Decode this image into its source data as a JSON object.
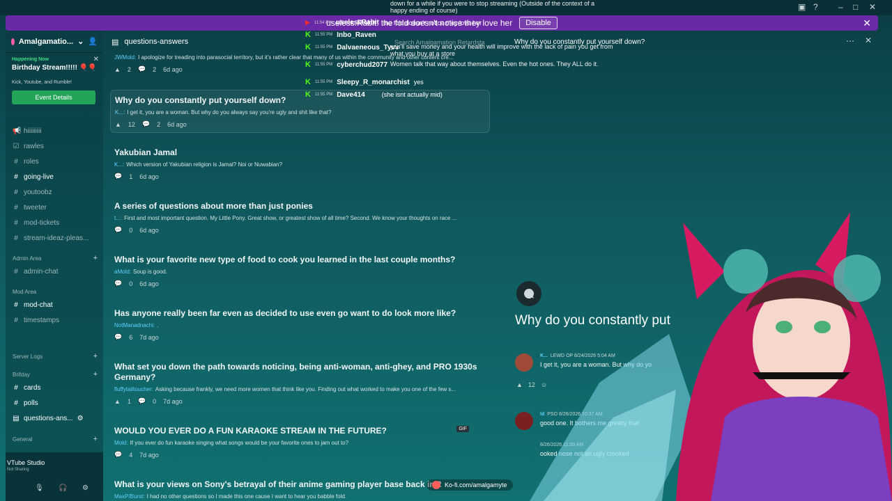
{
  "notice": {
    "text": "useless.Rabit: the fold doesn't notice they love her",
    "disable_label": "Disable"
  },
  "sidebar": {
    "server_name": "Amalgamatio...",
    "event": {
      "happening": "Happening Now",
      "title": "Birthday Stream!!!!! 🎈🎈",
      "location": "Kick, Youtube, and Rumble!",
      "button": "Event Details"
    },
    "channels": [
      {
        "icon": "megaphone-icon",
        "name": "hiiiiiiiii"
      },
      {
        "icon": "rules-icon",
        "name": "rawles"
      },
      {
        "icon": "hash-icon",
        "name": "roles"
      },
      {
        "icon": "hash-icon",
        "name": "going-live",
        "bright": true
      },
      {
        "icon": "hash-icon",
        "name": "youtoobz"
      },
      {
        "icon": "hash-icon",
        "name": "tweeter"
      },
      {
        "icon": "hash-icon",
        "name": "mod-tickets"
      },
      {
        "icon": "hash-icon",
        "name": "stream-ideaz-pleas..."
      }
    ],
    "cat_admin": "Admin Area",
    "admin_chat": "admin-chat",
    "cat_mod": "Mod Area",
    "mod_chat": "mod-chat",
    "timestamps": "timestamps",
    "cat_server_logs": "Server Logs",
    "cat_brifday": "Brifday",
    "cards": "cards",
    "polls": "polls",
    "qa": "questions-ans...",
    "cat_general": "General",
    "user_app": "VTube Studio",
    "user_sub": "Not Sharing"
  },
  "channel_header": {
    "name": "questions-answers",
    "search_placeholder": "Search Amalgamation Retardsta"
  },
  "threads": [
    {
      "title": "Why do you constantly put yourself down?",
      "author": "K...:",
      "preview": "I get it, you are a woman. But why do you always say you're ugly and shit like that?",
      "reacts": "12",
      "replies": "2",
      "age": "6d ago"
    },
    {
      "title": "Yakubian Jamal",
      "author": "K...:",
      "preview": "Which version of Yakubian religion is Jamal? Noi or Nuwabian?",
      "replies": "1",
      "age": "6d ago"
    },
    {
      "title": "A series of questions about more than just ponies",
      "author": "t...:",
      "preview": "First and most important question. My Little Pony. Great show, or greatest show of all time? Second. We know your thoughts on race ...",
      "replies": "0",
      "age": "6d ago"
    },
    {
      "title": "What is your favorite new type of food to cook you learned in the last couple months?",
      "author": "aMold:",
      "preview": "Soup is good.",
      "replies": "0",
      "age": "6d ago"
    },
    {
      "title": "Has anyone really been far even as decided to use even go want to do look more like?",
      "author": "NotManadnachi:",
      "preview": ".",
      "replies": "6",
      "age": "7d ago"
    },
    {
      "title": "What set you down the path towards noticing, being anti-woman, anti-ghey, and PRO 1930s Germany?",
      "author": "fluffytailtoucher:",
      "preview": "Asking because frankly, we need more women that think like you. Finding out what worked to make you one of the few s...",
      "reacts": "1",
      "replies": "0",
      "age": "7d ago"
    },
    {
      "title": "WOULD YOU EVER DO A FUN KARAOKE STREAM IN THE FUTURE?",
      "author": "Mold:",
      "preview": "If you ever do fun karaoke singing what songs would be your favorite ones to jam out to?",
      "replies": "4",
      "age": "7d ago",
      "gif": "GIF"
    },
    {
      "title": "What is your views on Sony's betrayal of their anime gaming player base back in 2",
      "author": "MaxP/Burst:",
      "preview": "I had no other questions so I made this one cause I want to hear you babble fold."
    }
  ],
  "top_thread": {
    "author": "JWMold:",
    "preview": "I apologize for treading into parasocial territory, but it's rather clear that many of us within the community and other content cre...",
    "reacts": "2",
    "replies": "2",
    "age": "6d ago"
  },
  "chat": [
    {
      "platform": "youtube",
      "time": "11:54 PM",
      "name": "uselessRabit",
      "msg": "the fold doesn't notice they love her"
    },
    {
      "platform": "kick",
      "time": "11:55 PM",
      "name": "Inbo_Raven",
      "msg": ""
    },
    {
      "platform": "kick",
      "time": "11:55 PM",
      "name": "Dalvaeneous_Tyvv",
      "msg": "you'll save money and your health will improve with the lack of pain you get from what you buy at a store"
    },
    {
      "platform": "kick",
      "time": "11:55 PM",
      "name": "cyberchud2077",
      "msg": "Women talk that way about themselves. Even the hot ones. They ALL do it."
    },
    {
      "platform": "kick",
      "time": "11:55 PM",
      "name": "Sleepy_R_monarchist",
      "msg": "yes"
    },
    {
      "platform": "kick",
      "time": "11:55 PM",
      "name": "Dave414",
      "msg": "(she isnt actually mid)"
    }
  ],
  "chat_top": "down for a while if you were to stop streaming (Outside of the context of a happy ending of course)",
  "detail": {
    "title": "Why do you constantly put yourself down?",
    "big_title": "Why do you constantly put",
    "msg1": {
      "name": "K...",
      "tag": "LEWD",
      "op": "OP",
      "date": "8/24/2026 5:04 AM",
      "body": "I get it, you are a woman. But why do yo"
    },
    "reacts": "12",
    "msg2": {
      "name": "ld",
      "tag": "PSO",
      "date": "8/26/2026 10:37 AM",
      "body": "good one. It bothers me greatly that"
    },
    "msg3": {
      "date": "8/26/2026 11:39 AM",
      "body": "ooked nose not an ugly crooked"
    }
  },
  "kofi": "Ko-fi.com/amalgamyte",
  "colors": {
    "accent": "#6a2aa6",
    "kick": "#53fc18",
    "event": "#23a559"
  }
}
